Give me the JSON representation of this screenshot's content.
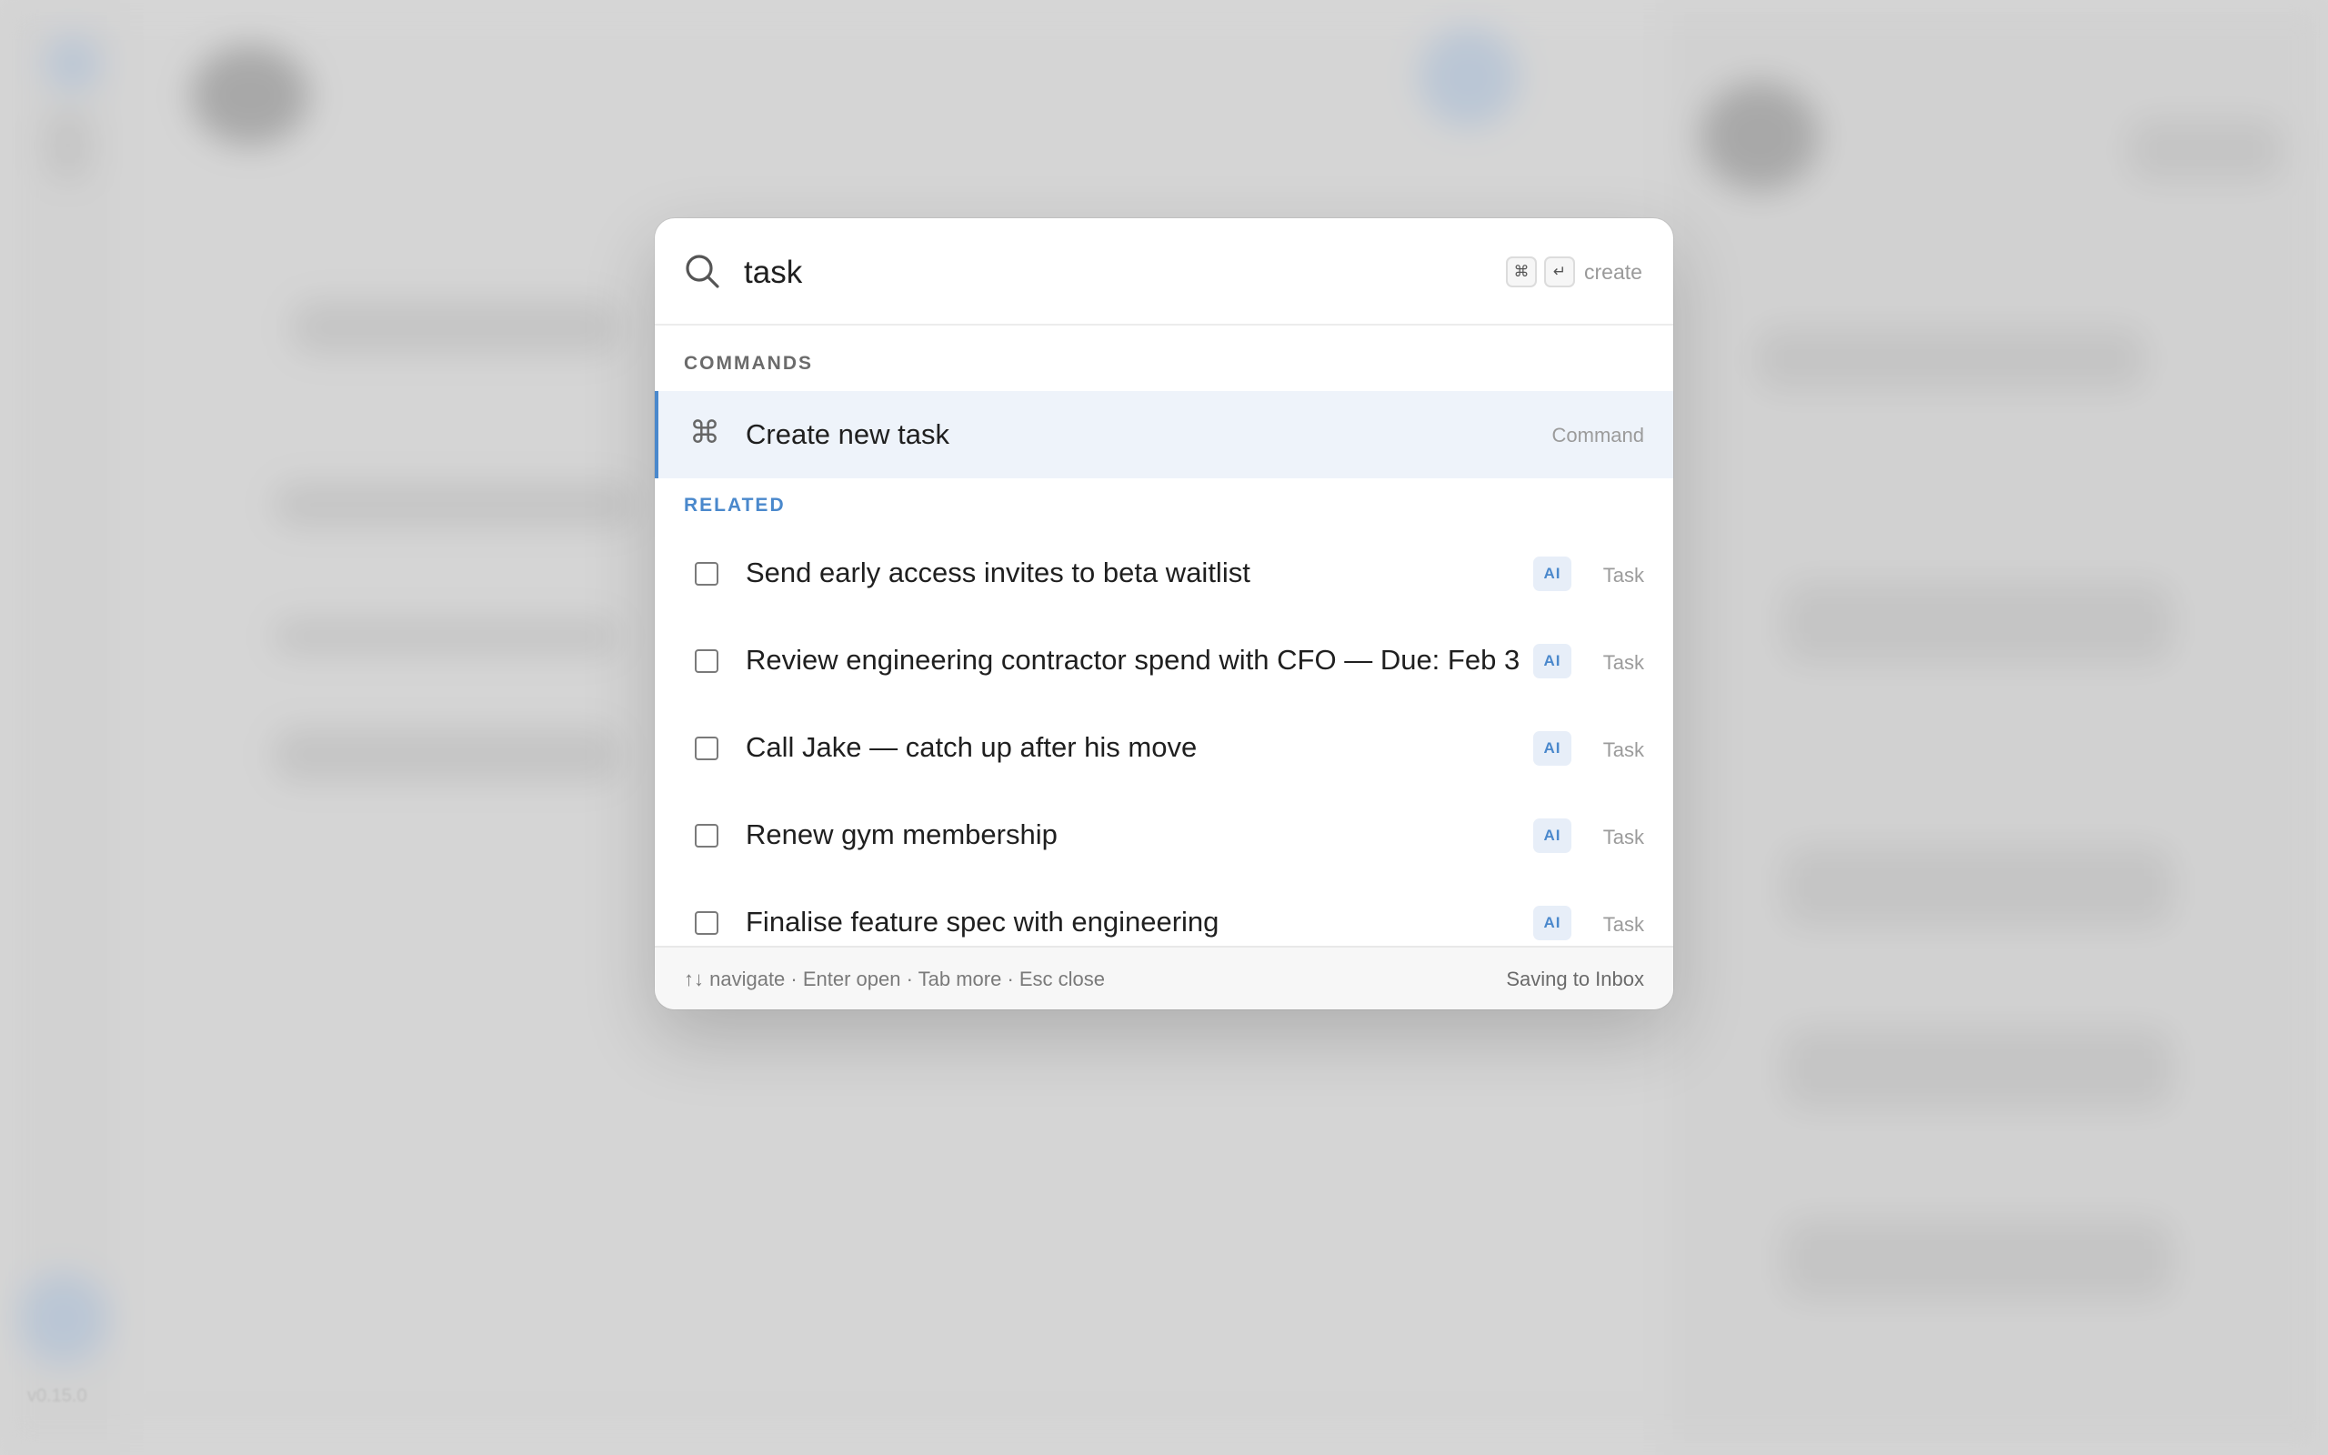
{
  "background": {
    "version": "v0.15.0"
  },
  "search": {
    "query": "task",
    "shortcut_keys": [
      "⌘",
      "↵"
    ],
    "shortcut_hint": "create"
  },
  "sections": {
    "commands_label": "COMMANDS",
    "related_label": "RELATED"
  },
  "commands": [
    {
      "label": "Create new task",
      "type": "Command",
      "icon": "command-icon"
    }
  ],
  "related": [
    {
      "label": "Send early access invites to beta waitlist",
      "badge": "AI",
      "type": "Task",
      "icon": "checkbox-icon"
    },
    {
      "label": "Review engineering contractor spend with CFO — Due: Feb 3",
      "badge": "AI",
      "type": "Task",
      "icon": "checkbox-icon"
    },
    {
      "label": "Call Jake — catch up after his move",
      "badge": "AI",
      "type": "Task",
      "icon": "checkbox-icon"
    },
    {
      "label": "Renew gym membership",
      "badge": "AI",
      "type": "Task",
      "icon": "checkbox-icon"
    },
    {
      "label": "Finalise feature spec with engineering",
      "badge": "AI",
      "type": "Task",
      "icon": "checkbox-icon"
    }
  ],
  "footer": {
    "hints": "↑↓ navigate · Enter open · Tab more · Esc close",
    "status": "Saving to Inbox"
  },
  "colors": {
    "accent": "#4a88cc",
    "selected_row": "#eef3fa",
    "badge_bg": "#e7eef8"
  }
}
